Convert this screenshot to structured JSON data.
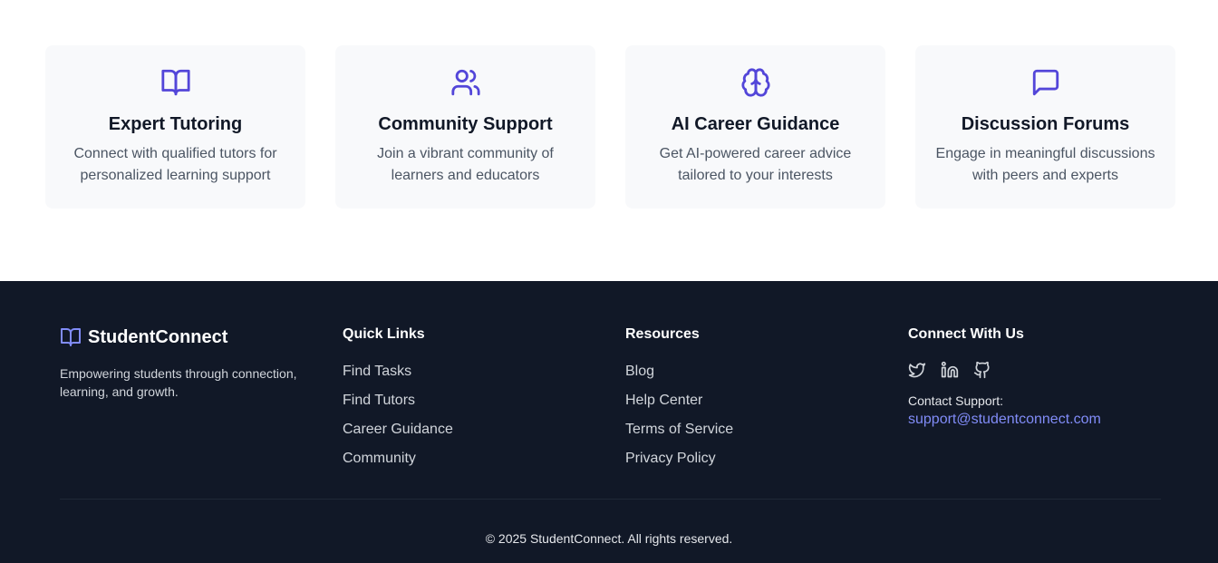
{
  "features": [
    {
      "icon": "book-open-icon",
      "title": "Expert Tutoring",
      "description": "Connect with qualified tutors for personalized learning support"
    },
    {
      "icon": "users-icon",
      "title": "Community Support",
      "description": "Join a vibrant community of learners and educators"
    },
    {
      "icon": "brain-icon",
      "title": "AI Career Guidance",
      "description": "Get AI-powered career advice tailored to your interests"
    },
    {
      "icon": "message-square-icon",
      "title": "Discussion Forums",
      "description": "Engage in meaningful discussions with peers and experts"
    }
  ],
  "footer": {
    "brand_name": "StudentConnect",
    "tagline": "Empowering students through connection, learning, and growth.",
    "quick_links": {
      "heading": "Quick Links",
      "items": [
        "Find Tasks",
        "Find Tutors",
        "Career Guidance",
        "Community"
      ]
    },
    "resources": {
      "heading": "Resources",
      "items": [
        "Blog",
        "Help Center",
        "Terms of Service",
        "Privacy Policy"
      ]
    },
    "connect": {
      "heading": "Connect With Us",
      "social": [
        "twitter-icon",
        "linkedin-icon",
        "github-icon"
      ],
      "support_label": "Contact Support:",
      "support_email": "support@studentconnect.com"
    },
    "copyright": "© 2025 StudentConnect. All rights reserved."
  },
  "colors": {
    "accent": "#5346d9",
    "accent_light": "#818cf8",
    "footer_bg": "#111827",
    "card_bg": "#f8f9fb"
  }
}
